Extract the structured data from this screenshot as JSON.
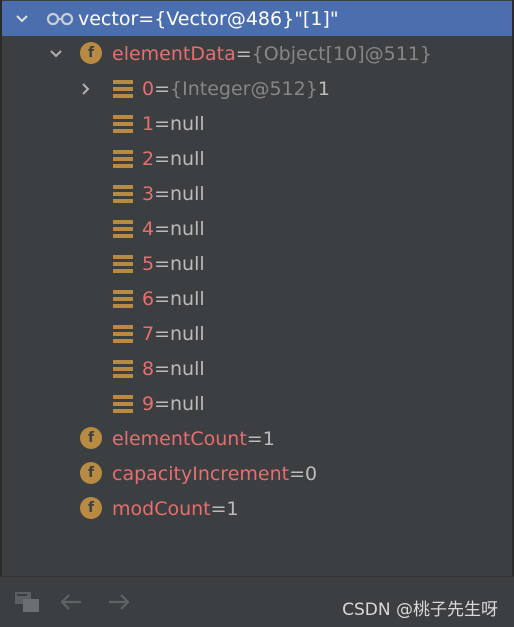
{
  "root": {
    "name": "vector",
    "eq": " = ",
    "type": "{Vector@486}",
    "value": " \"[1]\""
  },
  "elementData": {
    "name": "elementData",
    "eq": " = ",
    "type": "{Object[10]@511}"
  },
  "items": [
    {
      "index": "0",
      "eq": " = ",
      "type": "{Integer@512}",
      "value": " 1"
    },
    {
      "index": "1",
      "eq": " = ",
      "value": "null"
    },
    {
      "index": "2",
      "eq": " = ",
      "value": "null"
    },
    {
      "index": "3",
      "eq": " = ",
      "value": "null"
    },
    {
      "index": "4",
      "eq": " = ",
      "value": "null"
    },
    {
      "index": "5",
      "eq": " = ",
      "value": "null"
    },
    {
      "index": "6",
      "eq": " = ",
      "value": "null"
    },
    {
      "index": "7",
      "eq": " = ",
      "value": "null"
    },
    {
      "index": "8",
      "eq": " = ",
      "value": "null"
    },
    {
      "index": "9",
      "eq": " = ",
      "value": "null"
    }
  ],
  "fields": [
    {
      "name": "elementCount",
      "eq": " = ",
      "value": "1"
    },
    {
      "name": "capacityIncrement",
      "eq": " = ",
      "value": "0"
    },
    {
      "name": "modCount",
      "eq": " = ",
      "value": "1"
    }
  ],
  "field_icon_letter": "f",
  "icons": {
    "watch": "glasses-icon",
    "field": "field-icon",
    "array_item": "array-element-icon",
    "expanded": "chevron-down-icon",
    "collapsed": "chevron-right-icon",
    "back": "arrow-left-icon",
    "forward": "arrow-right-icon",
    "frames": "frames-icon"
  },
  "colors": {
    "background": "#3c3f41",
    "selection": "#4b6eaf",
    "field_name": "#e66e6e",
    "field_icon": "#b98b42",
    "type_text": "#868686"
  },
  "watermark": "CSDN @桃子先生呀"
}
